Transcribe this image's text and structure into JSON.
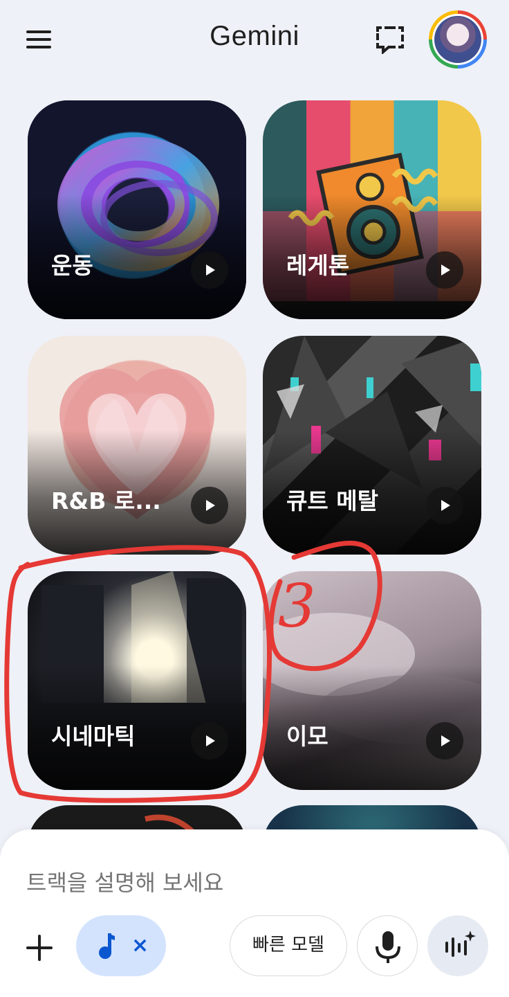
{
  "header": {
    "title": "Gemini",
    "menu_icon": "hamburger-menu-icon",
    "new_chat_icon": "new-chat-icon",
    "avatar_icon": "profile-avatar"
  },
  "cards": [
    {
      "label": "운동",
      "play_icon": "play-icon"
    },
    {
      "label": "레게톤",
      "play_icon": "play-icon"
    },
    {
      "label": "R&B 로...",
      "play_icon": "play-icon"
    },
    {
      "label": "큐트 메탈",
      "play_icon": "play-icon"
    },
    {
      "label": "시네마틱",
      "play_icon": "play-icon"
    },
    {
      "label": "이모",
      "play_icon": "play-icon"
    }
  ],
  "annotation": {
    "number": "3",
    "color": "#e53935"
  },
  "input": {
    "placeholder": "트랙을 설명해 보세요",
    "chip_close": "×",
    "model_label": "빠른 모델"
  },
  "colors": {
    "background": "#eef1f7",
    "chip_bg": "#d3e3fd",
    "accent": "#0b57d0"
  }
}
